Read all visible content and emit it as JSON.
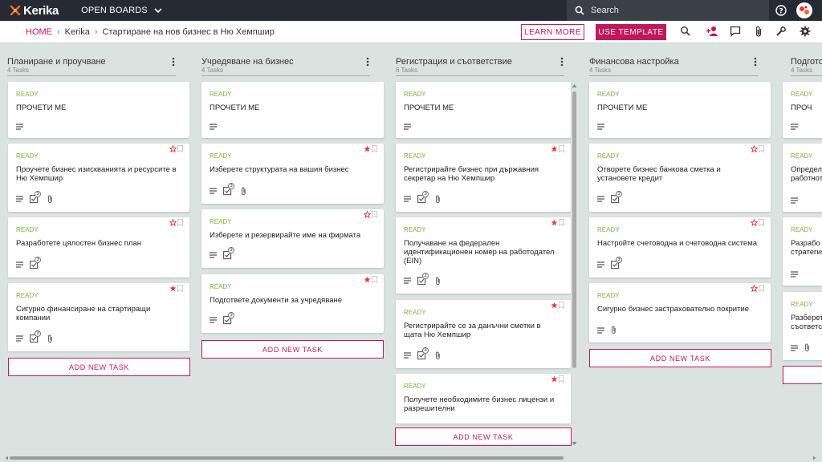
{
  "app": {
    "name": "Kerika",
    "open_boards": "OPEN BOARDS",
    "search_placeholder": "Search"
  },
  "breadcrumb": {
    "home": "HOME",
    "org": "Kerika",
    "board": "Стартиране на нов бизнес в Ню Хемпшир"
  },
  "toolbar": {
    "learn_more": "LEARN MORE",
    "use_template": "USE TEMPLATE"
  },
  "colors": {
    "accent": "#c2185b",
    "ready": "#7cb342",
    "topbar": "#262a33",
    "flag": "#e53935"
  },
  "columns": [
    {
      "title": "Планиране и проучване",
      "count": "4 Tasks",
      "cards": [
        {
          "status": "READY",
          "title": "ПРОЧЕТИ МЕ"
        },
        {
          "status": "READY",
          "title": "Проучете бизнес изискванията и ресурсите в Ню Хемпшир",
          "checklist": "3"
        },
        {
          "status": "READY",
          "title": "Разработете цялостен бизнес план",
          "checklist": "3"
        },
        {
          "status": "READY",
          "title": "Сигурно финансиране на стартиращи компании",
          "checklist": "3"
        }
      ],
      "add_task": "ADD NEW TASK"
    },
    {
      "title": "Учредяване на бизнес",
      "count": "4 Tasks",
      "cards": [
        {
          "status": "READY",
          "title": "ПРОЧЕТИ МЕ"
        },
        {
          "status": "READY",
          "title": "Изберете структурата на вашия бизнес",
          "checklist": "3"
        },
        {
          "status": "READY",
          "title": "Изберете и резервирайте име на фирмата",
          "checklist": "3"
        },
        {
          "status": "READY",
          "title": "Подгответе документи за учредяване",
          "checklist": "3"
        }
      ],
      "add_task": "ADD NEW TASK"
    },
    {
      "title": "Регистрация и съответствие",
      "count": "6 Tasks",
      "cards": [
        {
          "status": "READY",
          "title": "ПРОЧЕТИ МЕ"
        },
        {
          "status": "READY",
          "title": "Регистрирайте бизнес при държавния секретар на Ню Хемпшир",
          "checklist": "3"
        },
        {
          "status": "READY",
          "title": "Получаване на федерален идентификационен номер на работодател (EIN)",
          "checklist": "2"
        },
        {
          "status": "READY",
          "title": "Регистрирайте се за данъчни сметки в щата Ню Хемпшир",
          "checklist": "3"
        },
        {
          "status": "READY",
          "title": "Получете необходимите бизнес лицензи и разрешителни"
        }
      ],
      "add_task": "ADD NEW TASK"
    },
    {
      "title": "Финансова настройка",
      "count": "4 Tasks",
      "cards": [
        {
          "status": "READY",
          "title": "ПРОЧЕТИ МЕ"
        },
        {
          "status": "READY",
          "title": "Отворете бизнес банкова сметка и установете кредит",
          "checklist": "3"
        },
        {
          "status": "READY",
          "title": "Настройте счетоводна и счетоводна система",
          "checklist": "3"
        },
        {
          "status": "READY",
          "title": "Сигурно бизнес застрахователно покритие"
        }
      ],
      "add_task": "ADD NEW TASK"
    },
    {
      "title": "Подгото",
      "count": "4 Tasks",
      "cards": [
        {
          "status": "READY",
          "title": "ПРОЧ"
        },
        {
          "status": "READY",
          "title": "Определ работнот"
        },
        {
          "status": "READY",
          "title": "Разрабо стратегия"
        },
        {
          "status": "READY",
          "title": "Разберет съответст"
        }
      ]
    }
  ]
}
